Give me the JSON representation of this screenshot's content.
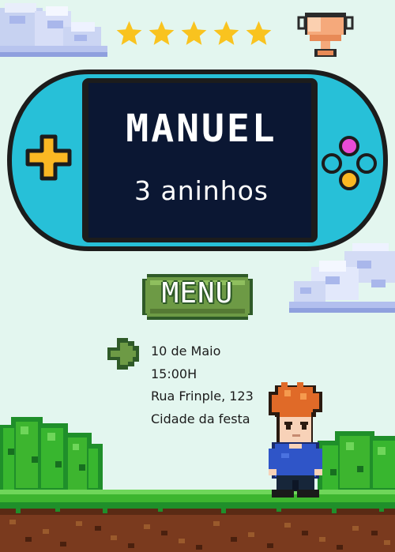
{
  "invitation": {
    "name": "MANUEL",
    "age": "3 aninhos",
    "menu_label": "MENU",
    "date": "10 de Maio",
    "time": "15:00H",
    "address": "Rua Frinple, 123",
    "city": "Cidade da festa"
  },
  "rating": {
    "stars_filled": 5,
    "stars_total": 5
  },
  "icons": [
    "cloud-icon",
    "star-icon",
    "trophy-icon",
    "game-console-icon",
    "dpad-icon",
    "action-buttons-icon",
    "menu-button-icon",
    "pointer-arrow-icon",
    "character-icon",
    "bush-icon",
    "ground-icon"
  ],
  "colors": {
    "background": "#e3f6ef",
    "console_body": "#27c0d8",
    "screen": "#0b1733",
    "star": "#f9c31f",
    "menu_green": "#6d9a45",
    "grass_green": "#3db52f",
    "dirt": "#7a3a1e"
  }
}
